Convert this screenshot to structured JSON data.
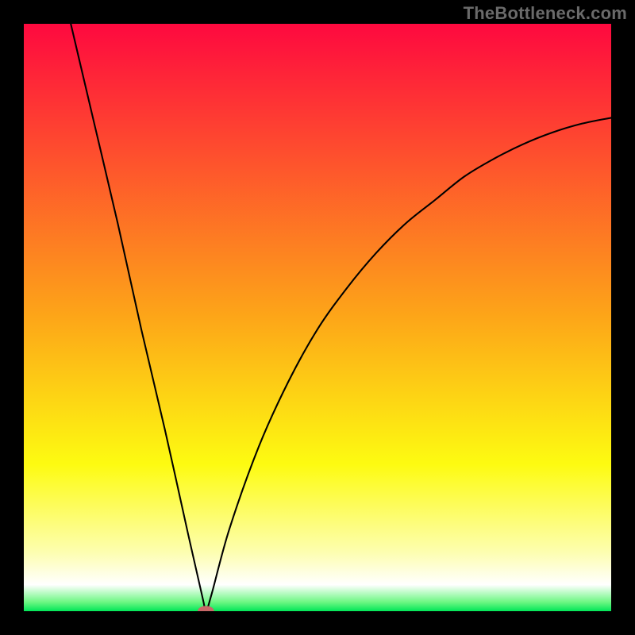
{
  "watermark": "TheBottleneck.com",
  "chart_data": {
    "type": "line",
    "title": "",
    "xlabel": "",
    "ylabel": "",
    "xlim": [
      0,
      100
    ],
    "ylim": [
      0,
      100
    ],
    "grid": false,
    "background_gradient": {
      "stops": [
        {
          "offset": 0.0,
          "color": "#fe093f"
        },
        {
          "offset": 0.5,
          "color": "#fda618"
        },
        {
          "offset": 0.75,
          "color": "#fdfb11"
        },
        {
          "offset": 0.9,
          "color": "#fdfeb0"
        },
        {
          "offset": 0.955,
          "color": "#ffffff"
        },
        {
          "offset": 0.985,
          "color": "#6af781"
        },
        {
          "offset": 1.0,
          "color": "#01e658"
        }
      ]
    },
    "curve": {
      "description": "V-shaped bottleneck curve with asymmetric arms; sharp minimum near x≈31, y≈0; left arm exits top near x≈8; right arm rises concave toward x=100, y≈84",
      "data_points_estimated": [
        {
          "x": 8.0,
          "y": 100.0
        },
        {
          "x": 12.0,
          "y": 83.0
        },
        {
          "x": 16.0,
          "y": 66.0
        },
        {
          "x": 20.0,
          "y": 48.0
        },
        {
          "x": 24.0,
          "y": 31.0
        },
        {
          "x": 28.0,
          "y": 13.0
        },
        {
          "x": 30.5,
          "y": 2.0
        },
        {
          "x": 31.0,
          "y": 0.0
        },
        {
          "x": 32.0,
          "y": 3.0
        },
        {
          "x": 35.0,
          "y": 14.0
        },
        {
          "x": 40.0,
          "y": 28.0
        },
        {
          "x": 45.0,
          "y": 39.0
        },
        {
          "x": 50.0,
          "y": 48.0
        },
        {
          "x": 55.0,
          "y": 55.0
        },
        {
          "x": 60.0,
          "y": 61.0
        },
        {
          "x": 65.0,
          "y": 66.0
        },
        {
          "x": 70.0,
          "y": 70.0
        },
        {
          "x": 75.0,
          "y": 74.0
        },
        {
          "x": 80.0,
          "y": 77.0
        },
        {
          "x": 85.0,
          "y": 79.5
        },
        {
          "x": 90.0,
          "y": 81.5
        },
        {
          "x": 95.0,
          "y": 83.0
        },
        {
          "x": 100.0,
          "y": 84.0
        }
      ]
    },
    "vertex_marker": {
      "x": 31.0,
      "y": 0.0,
      "color": "#c86868",
      "rx": 1.4,
      "ry": 0.9
    }
  }
}
